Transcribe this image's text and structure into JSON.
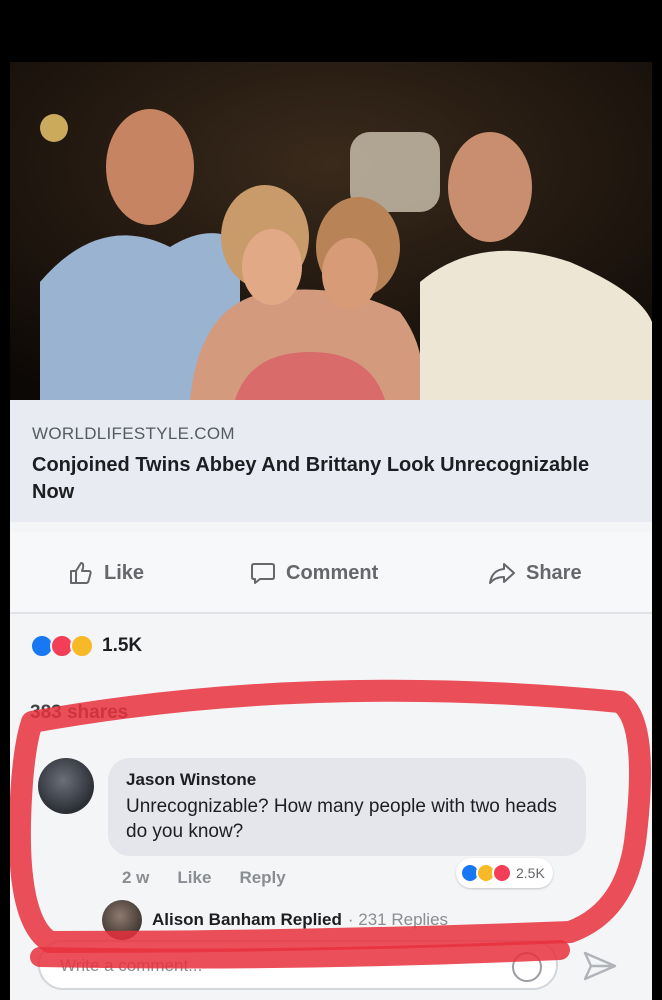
{
  "post": {
    "link": {
      "domain": "WORLDLIFESTYLE.COM",
      "headline": "Conjoined Twins Abbey And Brittany Look Unrecognizable Now"
    },
    "actions": {
      "like": "Like",
      "comment": "Comment",
      "share": "Share"
    },
    "reactions": {
      "icons": [
        "like-reaction-icon",
        "love-reaction-icon",
        "wow-reaction-icon"
      ],
      "count": "1.5K"
    },
    "shares": "383 shares"
  },
  "comment": {
    "author": "Jason Winstone",
    "text": "Unrecognizable? How many people with two heads do you know?",
    "age": "2 w",
    "like": "Like",
    "reply": "Reply",
    "reactions": {
      "icons": [
        "like-reaction-icon",
        "haha-reaction-icon",
        "love-reaction-icon"
      ],
      "count": "2.5K"
    }
  },
  "reply_summary": {
    "author_action": "Alison Banham Replied",
    "count": "· 231 Replies"
  },
  "composer": {
    "placeholder": "Write a comment..."
  },
  "colors": {
    "highlight": "#e8303d",
    "like_blue": "#1877f2",
    "love_red": "#f33e58",
    "haha_yellow": "#f7b928"
  }
}
